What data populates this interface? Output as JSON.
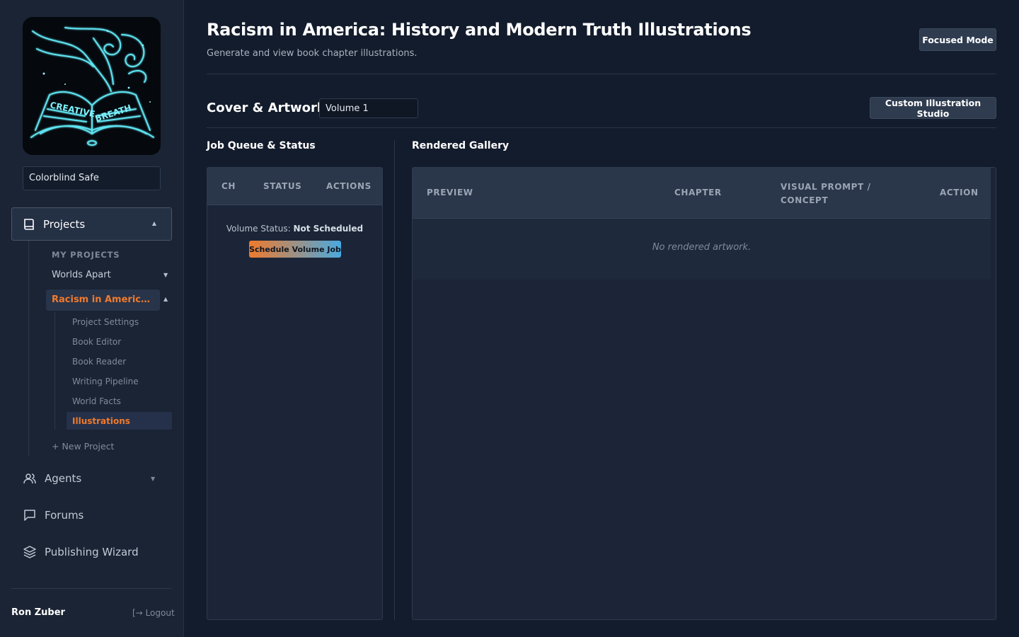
{
  "sidebar": {
    "logo": {
      "words": [
        "CREATIVE",
        "BREATH"
      ]
    },
    "theme_select": "Colorblind Safe",
    "projects_label": "Projects",
    "my_projects_heading": "MY PROJECTS",
    "projects": [
      {
        "label": "Worlds Apart",
        "expanded": false
      },
      {
        "label": "Racism in America: History and Modern Truth Illustrations",
        "expanded": true
      }
    ],
    "project_subitems": [
      {
        "label": "Project Settings",
        "active": false
      },
      {
        "label": "Book Editor",
        "active": false
      },
      {
        "label": "Book Reader",
        "active": false
      },
      {
        "label": "Writing Pipeline",
        "active": false
      },
      {
        "label": "World Facts",
        "active": false
      },
      {
        "label": "Illustrations",
        "active": true
      }
    ],
    "new_project": "+ New Project",
    "nav": [
      {
        "label": "Agents",
        "icon": "users-icon",
        "has_caret": true
      },
      {
        "label": "Forums",
        "icon": "chat-icon",
        "has_caret": false
      },
      {
        "label": "Publishing Wizard",
        "icon": "layers-icon",
        "has_caret": false
      }
    ],
    "user_name": "Ron Zuber",
    "logout": "Logout"
  },
  "header": {
    "title": "Racism in America: History and Modern Truth Illustrations",
    "subtitle": "Generate and view book chapter illustrations.",
    "focused_mode": "Focused Mode"
  },
  "cover_section": {
    "title": "Cover & Artwork",
    "volume": "Volume 1",
    "custom_studio": "Custom Illustration Studio"
  },
  "job_queue": {
    "heading": "Job Queue & Status",
    "columns": [
      "CH",
      "STATUS",
      "ACTIONS"
    ],
    "volume_status_label": "Volume Status:",
    "volume_status_value": "Not Scheduled",
    "schedule_button": "Schedule Volume Job"
  },
  "gallery": {
    "heading": "Rendered Gallery",
    "columns": [
      "PREVIEW",
      "CHAPTER",
      "VISUAL PROMPT /\nCONCEPT",
      "ACTION"
    ],
    "empty_message": "No rendered artwork."
  },
  "colors": {
    "accent_orange": "#f07a2c",
    "accent_blue": "#4aa9e0",
    "background": "#131c2c",
    "sidebar": "#1a2434"
  }
}
